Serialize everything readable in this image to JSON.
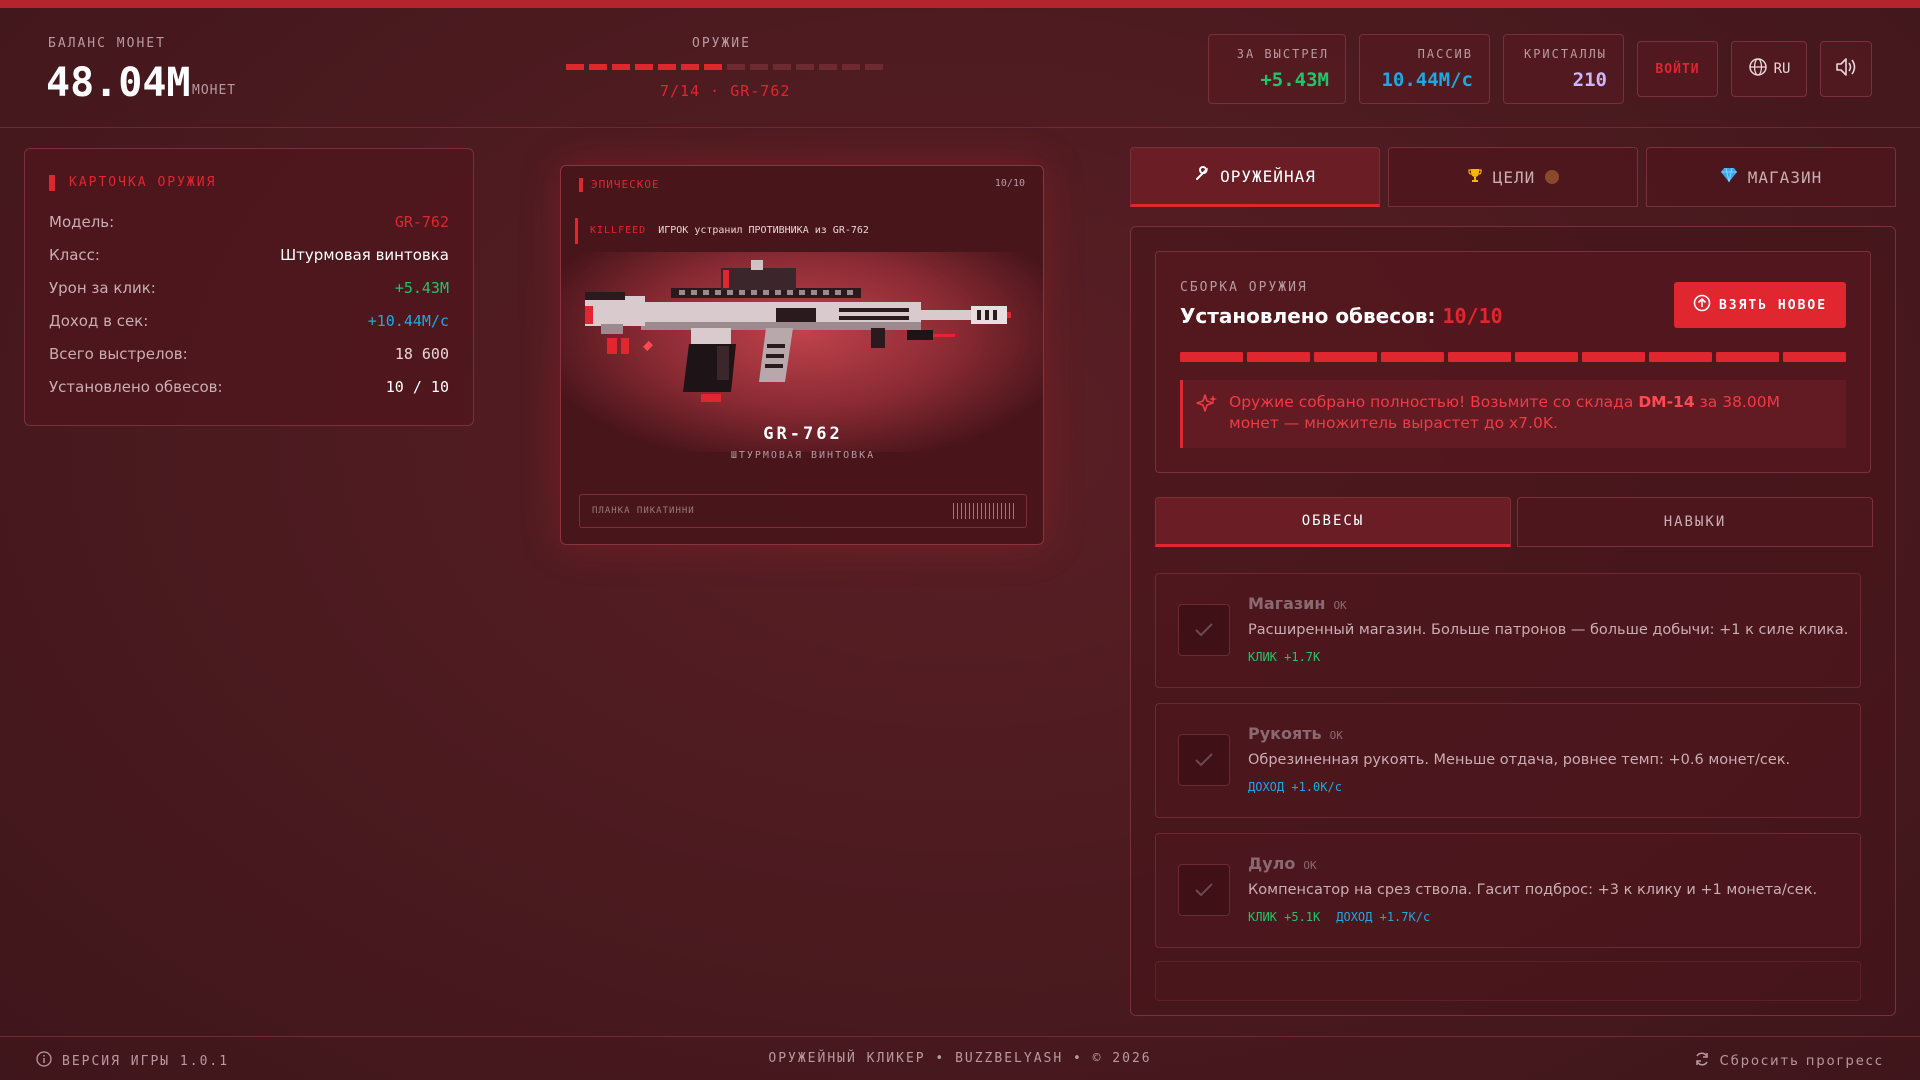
{
  "header": {
    "balance_label": "БАЛАНС МОНЕТ",
    "balance_value": "48.04M",
    "balance_unit": "МОНЕТ",
    "weapon_label": "ОРУЖИЕ",
    "weapon_progress": {
      "current": 7,
      "total": 14
    },
    "weapon_progress_text": "7/14 · GR-762",
    "stats": [
      {
        "label": "ЗА ВЫСТРЕЛ",
        "value": "+5.43M",
        "color": "#22c46a"
      },
      {
        "label": "ПАССИВ",
        "value": "10.44M/c",
        "color": "#1fa8e0"
      },
      {
        "label": "КРИСТАЛЛЫ",
        "value": "210",
        "color": "#c9b6ff"
      }
    ],
    "login_label": "ВОЙТИ",
    "lang_label": "RU",
    "lang_icon": "globe-icon",
    "sound_icon": "speaker-icon"
  },
  "info_card": {
    "title": "КАРТОЧКА ОРУЖИЯ",
    "rows": [
      {
        "key": "Модель:",
        "value": "GR-762",
        "color": "#e0262f"
      },
      {
        "key": "Класс:",
        "value": "Штурмовая винтовка",
        "color": "#ffffff"
      },
      {
        "key": "Урон за клик:",
        "value": "+5.43M",
        "color": "#22c46a"
      },
      {
        "key": "Доход в сек:",
        "value": "+10.44M/c",
        "color": "#1fa8e0"
      },
      {
        "key": "Всего выстрелов:",
        "value": "18 600",
        "color": "#e8d6d8"
      },
      {
        "key": "Установлено обвесов:",
        "value": "10 / 10",
        "color": "#ffffff"
      }
    ]
  },
  "weapon_card": {
    "rarity": "ЭПИЧЕСКОЕ",
    "count": "10/10",
    "killfeed_tag": "KILLFEED",
    "killfeed_text": "ИГРОК устранил ПРОТИВНИКА из GR-762",
    "name": "GR-762",
    "class": "ШТУРМОВАЯ ВИНТОВКА",
    "rail_label": "ПЛАНКА ПИКАТИННИ"
  },
  "tabs": [
    {
      "label": "ОРУЖЕЙНАЯ",
      "icon": "wrench-icon",
      "active": true
    },
    {
      "label": "ЦЕЛИ",
      "icon": "trophy-icon",
      "active": false
    },
    {
      "label": "МАГАЗИН",
      "icon": "diamond-icon",
      "active": false
    }
  ],
  "build": {
    "label": "СБОРКА ОРУЖИЯ",
    "title": "Установлено обвесов:",
    "count": "10/10",
    "filled": 10,
    "total": 10,
    "new_button": "ВЗЯТЬ НОВОЕ",
    "notice_pre": "Оружие собрано полностью! Возьмите со склада",
    "notice_weapon": "DM-14",
    "notice_post": "за 38.00M монет — множитель вырастет до x7.0K."
  },
  "subtabs": [
    {
      "label": "ОБВЕСЫ",
      "active": true
    },
    {
      "label": "НАВЫКИ",
      "active": false
    }
  ],
  "upgrades": [
    {
      "name": "Магазин",
      "status": "OK",
      "desc": "Расширенный магазин. Больше патронов — больше добычи: +1 к силе клика.",
      "tags": [
        {
          "text": "КЛИК +1.7K",
          "kind": "green"
        }
      ]
    },
    {
      "name": "Рукоять",
      "status": "OK",
      "desc": "Обрезиненная рукоять. Меньше отдача, ровнее темп: +0.6 монет/сек.",
      "tags": [
        {
          "text": "ДОХОД +1.0K/c",
          "kind": "blue"
        }
      ]
    },
    {
      "name": "Дуло",
      "status": "OK",
      "desc": "Компенсатор на срез ствола. Гасит подброс: +3 к клику и +1 монета/сек.",
      "tags": [
        {
          "text": "КЛИК +5.1K",
          "kind": "green"
        },
        {
          "text": "ДОХОД +1.7K/c",
          "kind": "blue"
        }
      ]
    }
  ],
  "footer": {
    "version": "ВЕРСИЯ ИГРЫ 1.0.1",
    "credits": "ОРУЖЕЙНЫЙ КЛИКЕР • BUZZBELYASH • © 2026",
    "reset": "Сбросить прогресс"
  }
}
